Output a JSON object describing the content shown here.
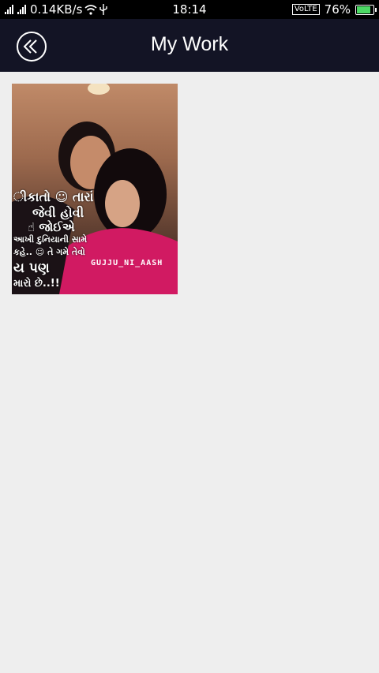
{
  "status_bar": {
    "network_speed": "0.14KB/s",
    "time": "18:14",
    "volte": "VoLTE",
    "battery_percent": "76%",
    "battery_level": 0.76
  },
  "app_bar": {
    "title": "My Work",
    "back_icon": "double-chevron-left-icon"
  },
  "works": [
    {
      "lines": [
        "ીકાતો ☺ તારાં",
        "જેવી હોવી",
        "☝ જોઈએ",
        "આખી દુનિયાની સામે",
        "કહે.. ☺ તે ગમે તેવો",
        "ય પણ",
        "મારો છે..!!"
      ],
      "watermark": "GUJJU_NI_AASH"
    }
  ],
  "colors": {
    "app_bar": "#131425",
    "background": "#eeeeee",
    "status_bar": "#000000"
  }
}
